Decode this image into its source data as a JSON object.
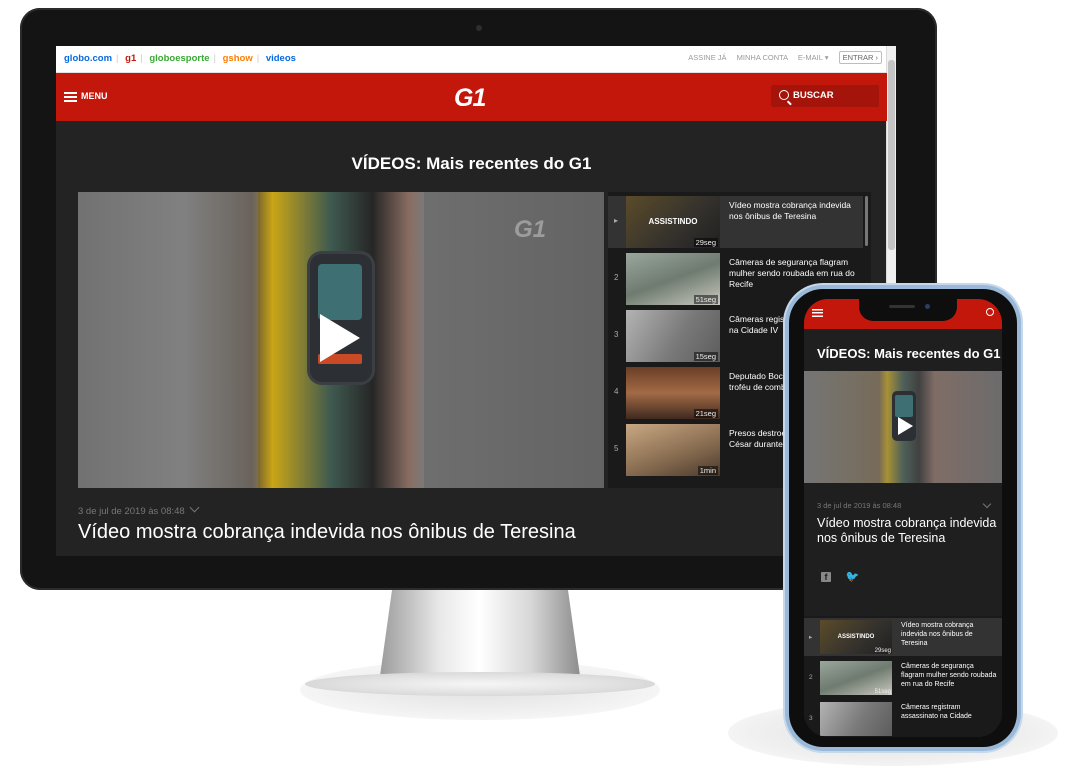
{
  "topbar": {
    "links": [
      {
        "label": "globo.com",
        "color": "#0669de"
      },
      {
        "label": "g1",
        "color": "#c4170c"
      },
      {
        "label": "globoesporte",
        "color": "#39a935"
      },
      {
        "label": "gshow",
        "color": "#ff7f00"
      },
      {
        "label": "videos",
        "color": "#0669de"
      }
    ],
    "assine": "ASSINE JÁ",
    "minha_conta": "MINHA CONTA",
    "email": "E-MAIL",
    "entrar": "ENTRAR"
  },
  "header": {
    "menu_label": "MENU",
    "logo": "G1",
    "search_label": "BUSCAR",
    "accent_color": "#c4170c"
  },
  "page": {
    "title": "VÍDEOS: Mais recentes do G1",
    "video_watermark": "G1",
    "video_date": "3 de jul de 2019 às 08:48",
    "video_title": "Vídeo mostra cobrança indevida nos ônibus de Teresina"
  },
  "playlist": [
    {
      "num": "",
      "assistindo": "ASSISTINDO",
      "duration": "29seg",
      "title": "Vídeo mostra cobrança indevida nos ônibus de Teresina",
      "thumb_color": "#8a7a55"
    },
    {
      "num": "2",
      "assistindo": "",
      "duration": "51seg",
      "title": "Câmeras de segurança flagram mulher sendo roubada em rua do Recife",
      "thumb_color": "#7f8a80"
    },
    {
      "num": "3",
      "assistindo": "",
      "duration": "15seg",
      "title": "Câmeras registram assassinato na Cidade IV",
      "thumb_color": "#8d8d8d"
    },
    {
      "num": "4",
      "assistindo": "",
      "duration": "21seg",
      "title": "Deputado Boca Aberta entrega troféu de combate à corrupção",
      "thumb_color": "#8c5a3c"
    },
    {
      "num": "5",
      "assistindo": "",
      "duration": "1min",
      "title": "Presos destroem cela no Major César durante",
      "thumb_color": "#b08f6a"
    }
  ],
  "phone": {
    "title": "VÍDEOS: Mais recentes do G1",
    "video_date": "3 de jul de 2019 às 08:48",
    "video_title": "Vídeo mostra cobrança indevida nos ônibus de Teresina",
    "social": {
      "facebook_icon": "f",
      "twitter_icon": "𝕏"
    },
    "playlist": [
      {
        "num": "",
        "assistindo": "ASSISTINDO",
        "duration": "29seg",
        "title": "Vídeo mostra cobrança indevida nos ônibus de Teresina",
        "thumb_color": "#8a7a55"
      },
      {
        "num": "2",
        "assistindo": "",
        "duration": "51seg",
        "title": "Câmeras de segurança flagram mulher sendo roubada em rua do Recife",
        "thumb_color": "#7f8a80"
      },
      {
        "num": "3",
        "assistindo": "",
        "duration": "",
        "title": "Câmeras registram assassinato na Cidade",
        "thumb_color": "#8d8d8d"
      }
    ]
  }
}
